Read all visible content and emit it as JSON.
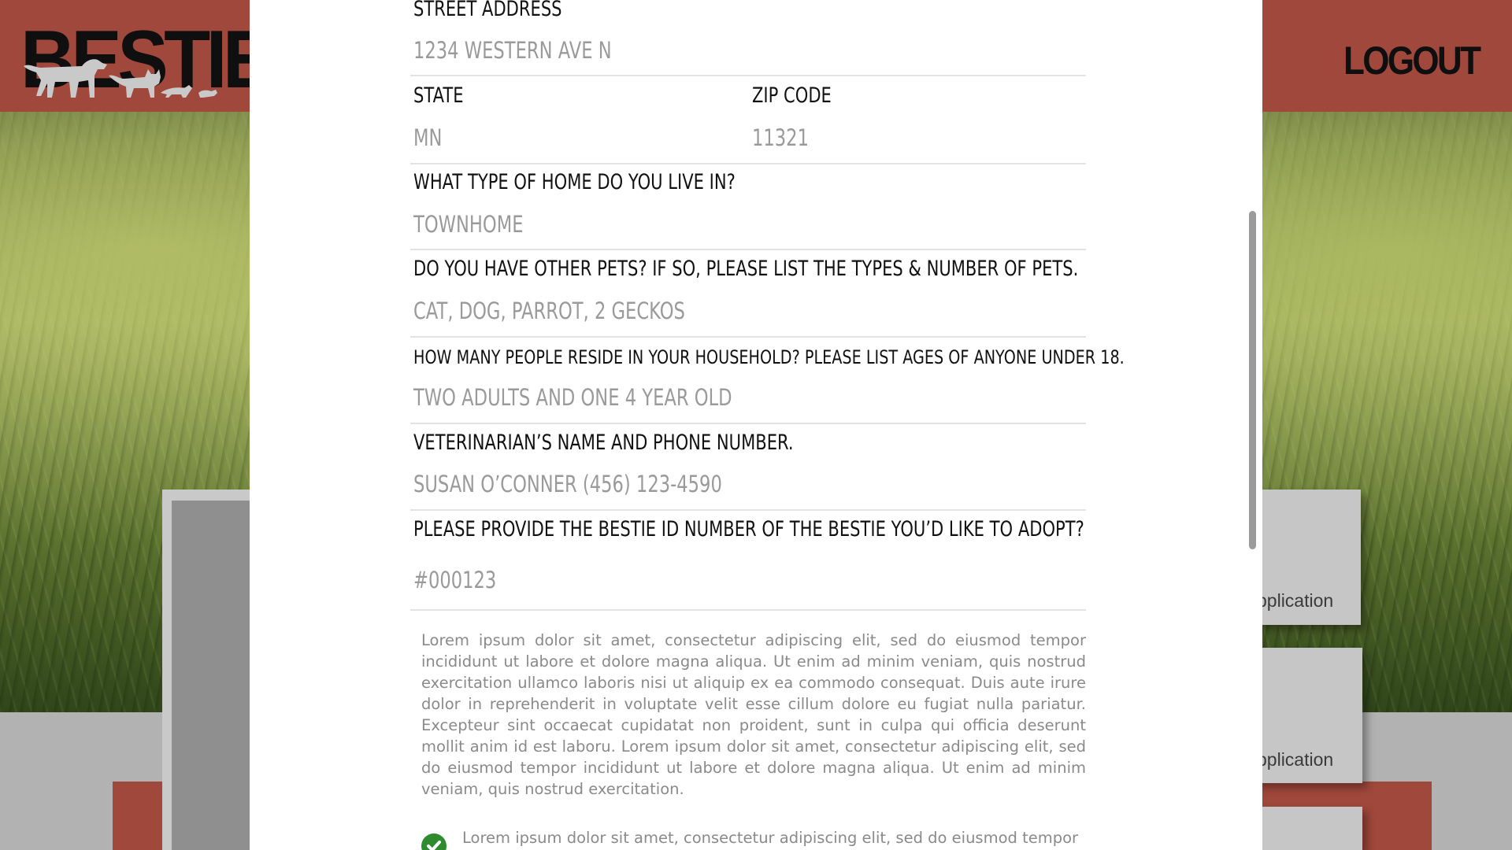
{
  "header": {
    "logo_text": "BESTIE",
    "logout_label": "LOGOUT"
  },
  "background_cards": [
    {
      "label": "pplication"
    },
    {
      "label": "pplication"
    }
  ],
  "form": {
    "fields": [
      {
        "label": "STREET ADDRESS",
        "value": "1234 WESTERN AVE N"
      },
      {
        "label": "STATE",
        "value": "MN"
      },
      {
        "label": "ZIP CODE",
        "value": "11321"
      },
      {
        "label": "WHAT TYPE OF HOME DO YOU LIVE IN?",
        "value": "TOWNHOME"
      },
      {
        "label": "DO YOU HAVE OTHER PETS? IF SO, PLEASE LIST THE TYPES & NUMBER OF PETS.",
        "value": "CAT,  DOG, PARROT, 2 GECKOS"
      },
      {
        "label": "HOW MANY PEOPLE RESIDE IN YOUR HOUSEHOLD? PLEASE LIST AGES OF ANYONE UNDER 18.",
        "value": "TWO ADULTS AND ONE 4 YEAR OLD"
      },
      {
        "label": "VETERINARIAN’S NAME AND PHONE NUMBER.",
        "value": "SUSAN O’CONNER (456) 123-4590"
      },
      {
        "label": "PLEASE PROVIDE THE BESTIE ID NUMBER OF THE BESTIE YOU’D LIKE TO ADOPT?",
        "value": "#000123"
      }
    ],
    "terms_text": "Lorem ipsum dolor sit amet, consectetur adipiscing elit, sed do eiusmod tempor incididunt ut labore et dolore magna aliqua. Ut enim ad minim veniam, quis nostrud exercitation ullamco laboris nisi ut aliquip ex ea commodo consequat. Duis aute irure dolor in reprehenderit in voluptate velit esse cillum dolore eu fugiat nulla pariatur. Excepteur sint occaecat cupidatat non proident, sunt in culpa qui officia deserunt mollit anim id est laboru. Lorem ipsum dolor sit amet, consectetur adipiscing elit, sed do eiusmod tempor incididunt ut labore et dolore magna aliqua. Ut enim ad minim veniam, quis nostrud exercitation.",
    "agreement_text": "Lorem ipsum dolor sit amet, consectetur adipiscing elit, sed do eiusmod tempor",
    "agreement_checked": true
  },
  "colors": {
    "brand_red": "#a0483b",
    "check_green": "#2e8b2e",
    "value_gray": "#9a9a9a"
  },
  "icons": {
    "logo_animals": "animal-silhouettes-icon",
    "checkbox": "checkmark-circle-icon"
  }
}
